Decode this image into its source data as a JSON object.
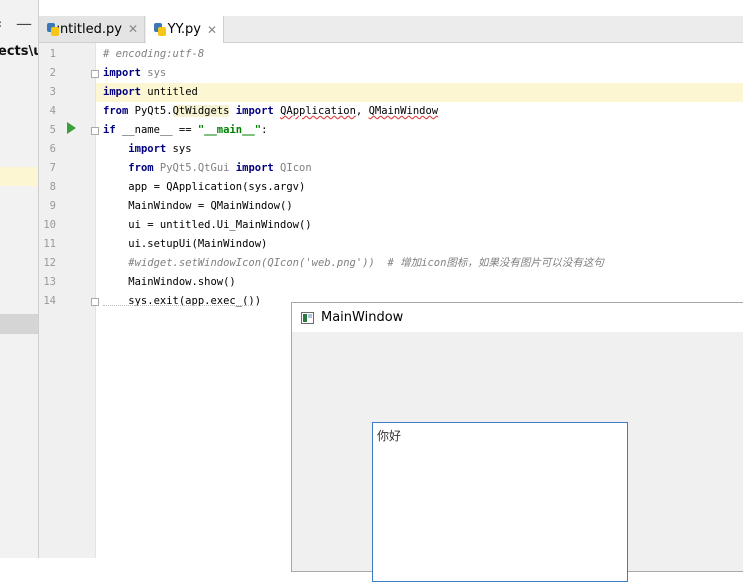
{
  "project_panel": {
    "path_text": "ects\\u",
    "hide_icon": "‹",
    "collapse_icon": "—"
  },
  "tabs": [
    {
      "label": "untitled.py",
      "active": false
    },
    {
      "label": "YY.py",
      "active": true
    }
  ],
  "editor": {
    "line_numbers": [
      "1",
      "2",
      "3",
      "4",
      "5",
      "6",
      "7",
      "8",
      "9",
      "10",
      "11",
      "12",
      "13",
      "14"
    ],
    "current_line": 3,
    "lines": [
      [
        {
          "t": "# encoding:utf-8",
          "c": "cm"
        }
      ],
      [
        {
          "t": "import",
          "c": "kw"
        },
        {
          "t": " sys",
          "c": "gray"
        }
      ],
      [
        {
          "t": "import",
          "c": "kw"
        },
        {
          "t": " untitled",
          "c": ""
        }
      ],
      [
        {
          "t": "from",
          "c": "kw"
        },
        {
          "t": " PyQt5.",
          "c": ""
        },
        {
          "t": "QtWidgets",
          "c": "hl"
        },
        {
          "t": " ",
          "c": ""
        },
        {
          "t": "import",
          "c": "kw"
        },
        {
          "t": " ",
          "c": ""
        },
        {
          "t": "QApplication",
          "c": "sq"
        },
        {
          "t": ", ",
          "c": ""
        },
        {
          "t": "QMainWindow",
          "c": "sq"
        }
      ],
      [
        {
          "t": "if",
          "c": "kw"
        },
        {
          "t": " __name__ == ",
          "c": ""
        },
        {
          "t": "\"__main__\"",
          "c": "str"
        },
        {
          "t": ":",
          "c": ""
        }
      ],
      [
        {
          "t": "    ",
          "c": ""
        },
        {
          "t": "import",
          "c": "kw"
        },
        {
          "t": " sys",
          "c": ""
        }
      ],
      [
        {
          "t": "    ",
          "c": ""
        },
        {
          "t": "from",
          "c": "kw"
        },
        {
          "t": " PyQt5.",
          "c": "gray"
        },
        {
          "t": "QtGui",
          "c": "gray"
        },
        {
          "t": " ",
          "c": ""
        },
        {
          "t": "import",
          "c": "kw"
        },
        {
          "t": " QIcon",
          "c": "gray"
        }
      ],
      [
        {
          "t": "    app = QApplication(sys.argv)",
          "c": ""
        }
      ],
      [
        {
          "t": "    MainWindow = QMainWindow()",
          "c": ""
        }
      ],
      [
        {
          "t": "    ui = untitled.Ui_MainWindow()",
          "c": ""
        }
      ],
      [
        {
          "t": "    ui.setupUi(MainWindow)",
          "c": ""
        }
      ],
      [
        {
          "t": "    ",
          "c": ""
        },
        {
          "t": "#widget.setWindowIcon(QIcon('web.png'))  # 增加icon图标，如果没有图片可以没有这句",
          "c": "cm"
        }
      ],
      [
        {
          "t": "    MainWindow.show()",
          "c": ""
        }
      ],
      [
        {
          "t": "    sys.exit(app.exec_())",
          "c": ""
        }
      ]
    ]
  },
  "qt_window": {
    "title": "MainWindow",
    "textbox_text": "你好"
  }
}
